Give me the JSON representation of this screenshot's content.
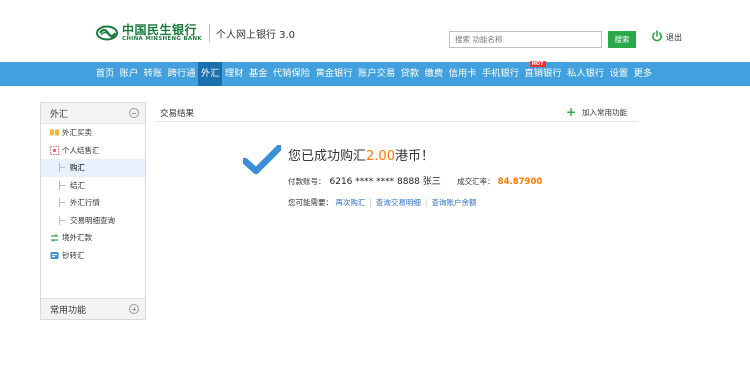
{
  "header": {
    "bank_name_cn": "中国民生银行",
    "bank_name_en": "CHINA MINSHENG BANK",
    "system_name": "个人网上银行 3.0",
    "search_placeholder": "搜索 功能名称",
    "search_button": "搜索",
    "logout_label": "退出"
  },
  "nav": {
    "items": [
      {
        "label": "首页"
      },
      {
        "label": "账户"
      },
      {
        "label": "转账"
      },
      {
        "label": "跨行通"
      },
      {
        "label": "外汇",
        "active": true
      },
      {
        "label": "理财"
      },
      {
        "label": "基金"
      },
      {
        "label": "代销保险"
      },
      {
        "label": "黄金银行"
      },
      {
        "label": "账户交易"
      },
      {
        "label": "贷款"
      },
      {
        "label": "缴费"
      },
      {
        "label": "信用卡"
      },
      {
        "label": "手机银行"
      },
      {
        "label": "直销银行",
        "badge": "HOT"
      },
      {
        "label": "私人银行"
      },
      {
        "label": "设置"
      },
      {
        "label": "更多"
      }
    ]
  },
  "sidebar": {
    "title": "外汇",
    "items": [
      {
        "label": "外汇买卖",
        "icon": "exchange-icon"
      },
      {
        "label": "个人结售汇",
        "icon": "settlement-icon"
      },
      {
        "label": "购汇",
        "sub": true,
        "selected": true
      },
      {
        "label": "结汇",
        "sub": true
      },
      {
        "label": "外汇行情",
        "sub": true
      },
      {
        "label": "交易明细查询",
        "sub": true
      },
      {
        "label": "境外汇款",
        "icon": "remittance-icon"
      },
      {
        "label": "钞转汇",
        "icon": "cash-transfer-icon"
      }
    ],
    "footer_title": "常用功能"
  },
  "main": {
    "title": "交易结果",
    "add_favorite": "加入常用功能",
    "success_prefix": "您已成功购汇",
    "success_amount": "2.00",
    "success_suffix": "港币！",
    "account_label": "付款账号：",
    "account_value": "6216 **** **** 8888 张三",
    "rate_label": "成交汇率：",
    "rate_value": "84.87900",
    "need_label": "您可能需要：",
    "links": [
      {
        "label": "再次购汇"
      },
      {
        "label": "查询交易明细"
      },
      {
        "label": "查询账户余额"
      }
    ]
  },
  "colors": {
    "nav_bg": "#41a0dd",
    "nav_active": "#1a6fad",
    "brand_green": "#1a7a3c",
    "accent_orange": "#ff7a00",
    "success_check": "#3a8fd6",
    "link_blue": "#2f6fc6"
  }
}
